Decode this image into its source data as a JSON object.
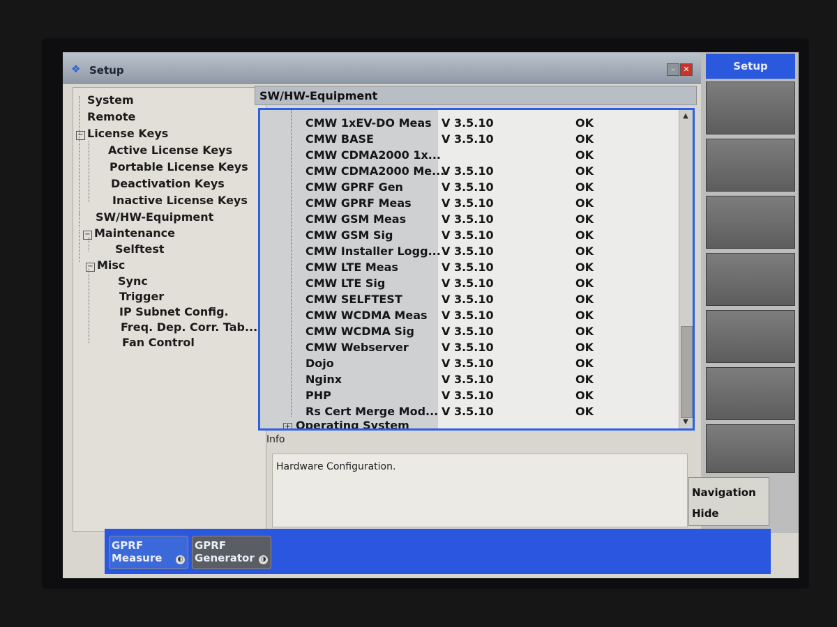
{
  "window": {
    "title": "Setup"
  },
  "tree": {
    "items": [
      {
        "label": "System",
        "level": 0,
        "expandable": false
      },
      {
        "label": "Remote",
        "level": 0,
        "expandable": false
      },
      {
        "label": "License Keys",
        "level": 0,
        "expandable": true
      },
      {
        "label": "Active License Keys",
        "level": 1,
        "expandable": false
      },
      {
        "label": "Portable License Keys",
        "level": 1,
        "expandable": false
      },
      {
        "label": "Deactivation Keys",
        "level": 1,
        "expandable": false
      },
      {
        "label": "Inactive License Keys",
        "level": 1,
        "expandable": false
      },
      {
        "label": "SW/HW-Equipment",
        "level": 0,
        "expandable": false
      },
      {
        "label": "Maintenance",
        "level": 0,
        "expandable": true
      },
      {
        "label": "Selftest",
        "level": 1,
        "expandable": false
      },
      {
        "label": "Misc",
        "level": 0,
        "expandable": true
      },
      {
        "label": "Sync",
        "level": 1,
        "expandable": false
      },
      {
        "label": "Trigger",
        "level": 1,
        "expandable": false
      },
      {
        "label": "IP Subnet Config.",
        "level": 1,
        "expandable": false
      },
      {
        "label": "Freq. Dep. Corr. Tab...",
        "level": 1,
        "expandable": false
      },
      {
        "label": "Fan Control",
        "level": 1,
        "expandable": false
      }
    ]
  },
  "main": {
    "title": "SW/HW-Equipment",
    "rows": [
      {
        "name": "CMW 1xEV-DO Meas",
        "version": "V 3.5.10",
        "status": "OK"
      },
      {
        "name": "CMW BASE",
        "version": "V 3.5.10",
        "status": "OK"
      },
      {
        "name": "CMW CDMA2000 1x...",
        "version": "",
        "status": "OK"
      },
      {
        "name": "CMW CDMA2000 Me...",
        "version": "V 3.5.10",
        "status": "OK"
      },
      {
        "name": "CMW GPRF Gen",
        "version": "V 3.5.10",
        "status": "OK"
      },
      {
        "name": "CMW GPRF Meas",
        "version": "V 3.5.10",
        "status": "OK"
      },
      {
        "name": "CMW GSM Meas",
        "version": "V 3.5.10",
        "status": "OK"
      },
      {
        "name": "CMW GSM Sig",
        "version": "V 3.5.10",
        "status": "OK"
      },
      {
        "name": "CMW Installer Logg...",
        "version": "V 3.5.10",
        "status": "OK"
      },
      {
        "name": "CMW LTE Meas",
        "version": "V 3.5.10",
        "status": "OK"
      },
      {
        "name": "CMW LTE Sig",
        "version": "V 3.5.10",
        "status": "OK"
      },
      {
        "name": "CMW SELFTEST",
        "version": "V 3.5.10",
        "status": "OK"
      },
      {
        "name": "CMW WCDMA Meas",
        "version": "V 3.5.10",
        "status": "OK"
      },
      {
        "name": "CMW WCDMA Sig",
        "version": "V 3.5.10",
        "status": "OK"
      },
      {
        "name": "CMW Webserver",
        "version": "V 3.5.10",
        "status": "OK"
      },
      {
        "name": "Dojo",
        "version": "V 3.5.10",
        "status": "OK"
      },
      {
        "name": "Nginx",
        "version": "V 3.5.10",
        "status": "OK"
      },
      {
        "name": "PHP",
        "version": "V 3.5.10",
        "status": "OK"
      },
      {
        "name": "Rs Cert Merge Mod...",
        "version": "V 3.5.10",
        "status": "OK"
      }
    ],
    "collapsed_group": "Operating System",
    "info_label": "Info",
    "info_text": "Hardware Configuration."
  },
  "softkeys": {
    "top": "Setup",
    "nav_line1": "Navigation",
    "nav_line2": "Hide"
  },
  "taskbar": {
    "buttons": [
      {
        "line1": "GPRF",
        "line2": "Measure"
      },
      {
        "line1": "GPRF",
        "line2": "Generator"
      }
    ]
  },
  "colors": {
    "accent": "#2a5fe6",
    "taskbar": "#2b57e0"
  }
}
